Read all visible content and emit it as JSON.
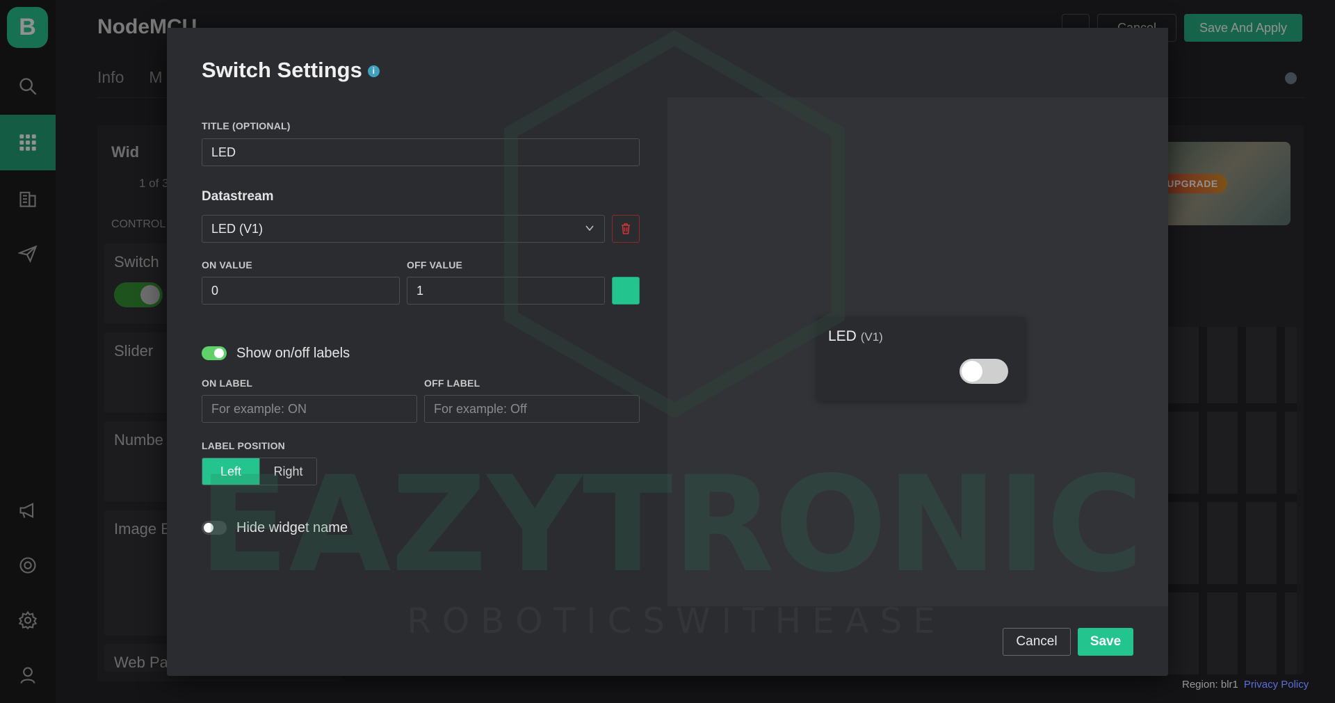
{
  "app": {
    "logo_letter": "B",
    "device_title": "NodeMCU",
    "tabs": [
      "Info",
      "M"
    ],
    "top_buttons": {
      "more": "...",
      "cancel": "Cancel",
      "save_apply": "Save And Apply"
    },
    "widget_box": {
      "title": "Wid",
      "counter": "1 of 3",
      "section": "CONTROL"
    },
    "widget_cards": [
      "Switch",
      "Slider",
      "Numbe",
      "Image E",
      "Web Pa"
    ],
    "upgrade_badge": "UPGRADE",
    "footer": {
      "region": "Region: blr1",
      "privacy": "Privacy Policy"
    },
    "colors": {
      "accent": "#23c48e",
      "rail": "#141516",
      "danger": "#c9302c"
    }
  },
  "rail": {
    "icons": [
      "search-icon",
      "dashboard-icon",
      "building-icon",
      "send-icon",
      "megaphone-icon",
      "lifebuoy-icon",
      "gear-icon",
      "user-icon"
    ]
  },
  "modal": {
    "title": "Switch Settings",
    "info": "i",
    "title_field": {
      "label": "TITLE (OPTIONAL)",
      "value": "LED"
    },
    "datastream": {
      "label": "Datastream",
      "selected": "LED (V1)"
    },
    "on_value": {
      "label": "ON VALUE",
      "value": "0"
    },
    "off_value": {
      "label": "OFF VALUE",
      "value": "1"
    },
    "widget_color": "#23c48e",
    "show_labels": {
      "label": "Show on/off labels",
      "enabled": true
    },
    "on_label": {
      "label": "ON LABEL",
      "placeholder": "For example: ON"
    },
    "off_label": {
      "label": "OFF LABEL",
      "placeholder": "For example: Off"
    },
    "label_position": {
      "label": "LABEL POSITION",
      "options": [
        "Left",
        "Right"
      ],
      "selected": "Left"
    },
    "hide_name": {
      "label": "Hide widget name",
      "enabled": false
    },
    "preview": {
      "name": "LED",
      "pin": "(V1)",
      "state_on": false
    },
    "buttons": {
      "cancel": "Cancel",
      "save": "Save"
    }
  },
  "watermark": {
    "brand": "EAZYTRONIC",
    "tagline": "R O B O T I C S   W I T H   E A S E"
  }
}
